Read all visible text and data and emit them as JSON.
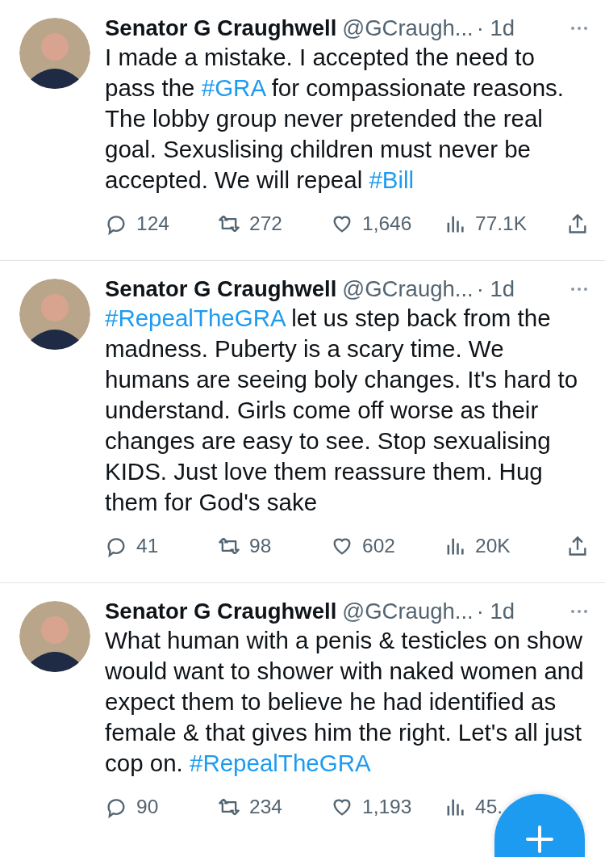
{
  "tweets": [
    {
      "name": "Senator G Craughwell",
      "handle": "@GCraugh...",
      "time": "· 1d",
      "text": [
        {
          "kind": "text",
          "t": "I made a mistake. I accepted the need to pass the "
        },
        {
          "kind": "hashtag",
          "t": "#GRA"
        },
        {
          "kind": "text",
          "t": " for compassionate reasons. The lobby group never pretended the real goal.  Sexuslising children must never be accepted. We will repeal "
        },
        {
          "kind": "hashtag",
          "t": "#Bill"
        }
      ],
      "replies": "124",
      "retweets": "272",
      "likes": "1,646",
      "views": "77.1K"
    },
    {
      "name": "Senator G Craughwell",
      "handle": "@GCraugh...",
      "time": "· 1d",
      "text": [
        {
          "kind": "hashtag",
          "t": "#RepealTheGRA"
        },
        {
          "kind": "text",
          "t": " let us step back from the madness.  Puberty is a scary time.  We humans are seeing boly changes. It's hard to understand. Girls come off worse as their changes are easy to see. Stop sexualising KIDS.  Just love them reassure them. Hug them for God's sake"
        }
      ],
      "replies": "41",
      "retweets": "98",
      "likes": "602",
      "views": "20K"
    },
    {
      "name": "Senator G Craughwell",
      "handle": "@GCraugh...",
      "time": "· 1d",
      "text": [
        {
          "kind": "text",
          "t": "What human with a penis & testicles on show would want to shower with naked women and expect them to believe he had identified as female & that gives him the right. Let's all just cop on. "
        },
        {
          "kind": "hashtag",
          "t": "#RepealTheGRA"
        }
      ],
      "replies": "90",
      "retweets": "234",
      "likes": "1,193",
      "views": "45."
    }
  ]
}
